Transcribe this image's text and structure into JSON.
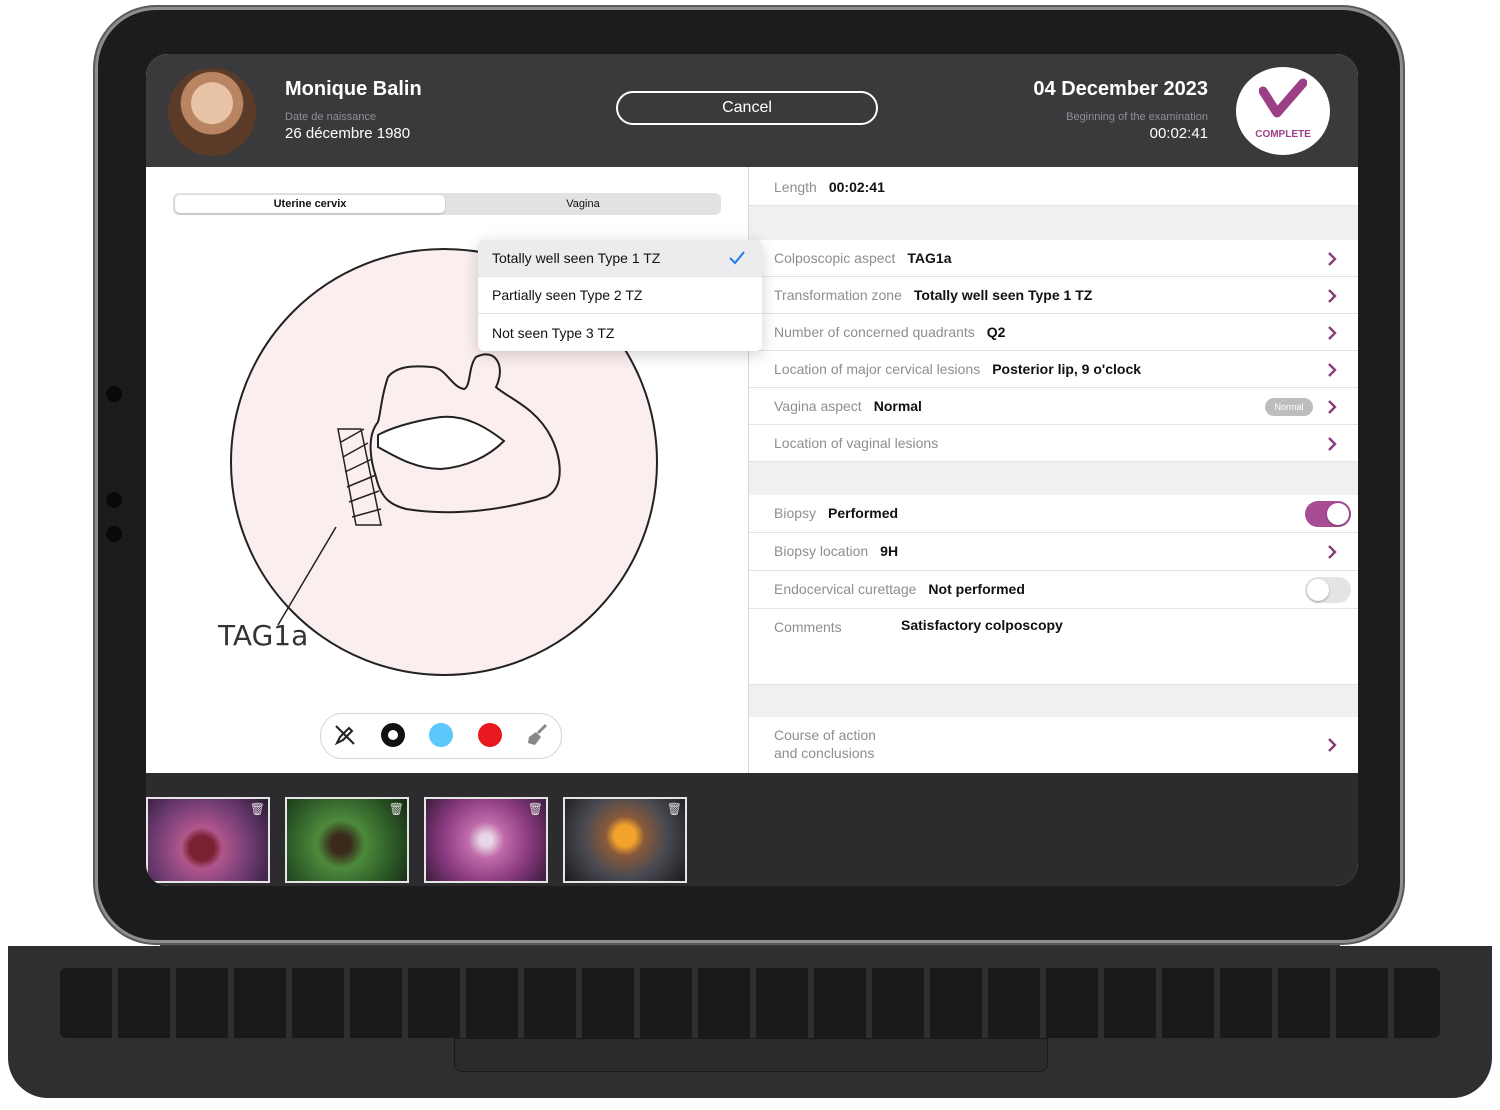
{
  "header": {
    "patient_name": "Monique Balin",
    "dob_label": "Date de naissance",
    "dob": "26 décembre 1980",
    "cancel_label": "Cancel",
    "exam_date": "04 December 2023",
    "begin_label": "Beginning of the examination",
    "begin_time": "00:02:41",
    "status_label": "COMPLETE"
  },
  "tabs": {
    "active": "Uterine cervix",
    "inactive": "Vagina"
  },
  "drawing": {
    "annotation": "TAG1a"
  },
  "dropdown": {
    "options": [
      "Totally well seen Type 1 TZ",
      "Partially seen Type 2 TZ",
      "Not seen Type 3 TZ"
    ],
    "selected_index": 0
  },
  "toolbar": {
    "tools": [
      "pencil-off-icon",
      "black-color",
      "blue-color",
      "red-color",
      "broom-icon"
    ],
    "colors": {
      "black": "#111111",
      "blue": "#5ac8fa",
      "red": "#e8191e"
    }
  },
  "form": {
    "length": {
      "label": "Length",
      "value": "00:02:41"
    },
    "colposcopic_aspect": {
      "label": "Colposcopic aspect",
      "value": "TAG1a"
    },
    "transformation_zone": {
      "label": "Transformation zone",
      "value": "Totally well seen Type 1 TZ"
    },
    "quadrants": {
      "label": "Number of concerned quadrants",
      "value": "Q2"
    },
    "major_lesions": {
      "label": "Location of major cervical lesions",
      "value": "Posterior lip, 9 o'clock"
    },
    "vagina_aspect": {
      "label": "Vagina aspect",
      "value": "Normal",
      "badge": "Normal"
    },
    "vaginal_lesions": {
      "label": "Location of vaginal lesions",
      "value": ""
    },
    "biopsy": {
      "label": "Biopsy",
      "value": "Performed",
      "toggle": true
    },
    "biopsy_location": {
      "label": "Biopsy location",
      "value": "9H"
    },
    "endocervical": {
      "label": "Endocervical curettage",
      "value": "Not performed",
      "toggle": false
    },
    "comments": {
      "label": "Comments",
      "value": "Satisfactory colposcopy"
    },
    "course_line1": "Course of action",
    "course_line2": "and conclusions"
  },
  "colors": {
    "accent": "#a84c94",
    "header_bg": "#3a3a3c"
  }
}
